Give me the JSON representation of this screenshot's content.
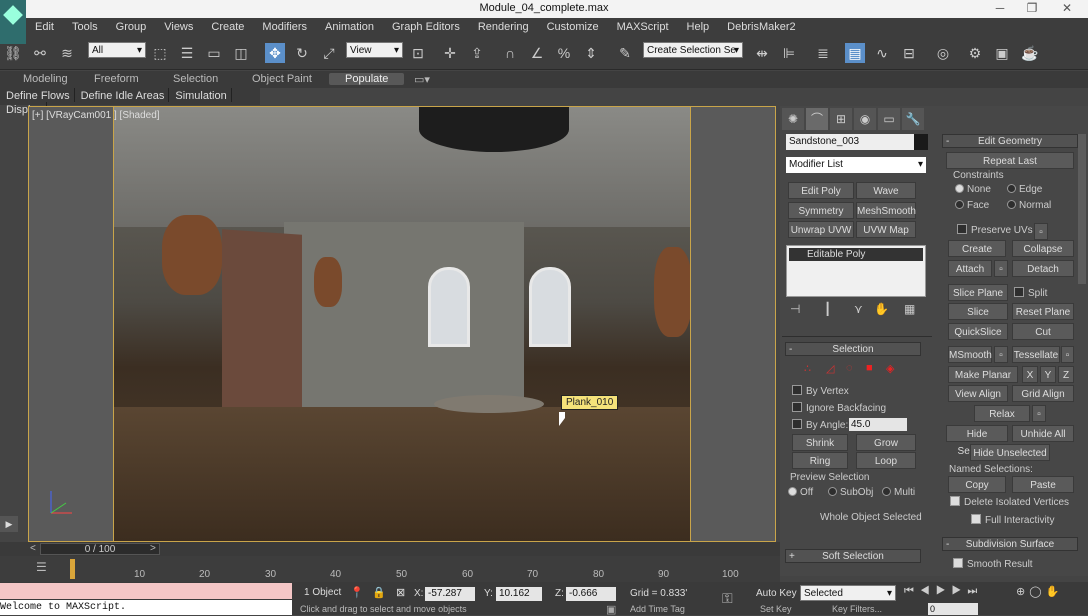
{
  "window": {
    "title": "Module_04_complete.max",
    "minimize": "─",
    "maximize": "❐",
    "close": "✕"
  },
  "menu": [
    "Edit",
    "Tools",
    "Group",
    "Views",
    "Create",
    "Modifiers",
    "Animation",
    "Graph Editors",
    "Rendering",
    "Customize",
    "MAXScript",
    "Help",
    "DebrisMaker2"
  ],
  "toolbar": {
    "filter": "All",
    "refcoord": "View",
    "selection_set_placeholder": "Create Selection Se"
  },
  "ribbon": {
    "tabs": [
      "Modeling",
      "Freeform",
      "Selection",
      "Object Paint",
      "Populate"
    ],
    "active": "Populate"
  },
  "subribbon": [
    "Define Flows",
    "Define Idle Areas",
    "Simulation",
    "Display"
  ],
  "viewport": {
    "label": "[+] [VRayCam001 ] [Shaded]",
    "tooltip": "Plank_010"
  },
  "command_panel": {
    "object_name": "Sandstone_003",
    "modifier_list": "Modifier List",
    "modifier_buttons": [
      "Edit Poly",
      "Wave",
      "Symmetry",
      "MeshSmooth",
      "Unwrap UVW",
      "UVW Map"
    ],
    "stack": [
      "Editable Poly"
    ],
    "selection": {
      "title": "Selection",
      "by_vertex": "By Vertex",
      "ignore_backfacing": "Ignore Backfacing",
      "by_angle": "By Angle:",
      "angle_value": "45.0",
      "shrink": "Shrink",
      "grow": "Grow",
      "ring": "Ring",
      "loop": "Loop",
      "preview_title": "Preview Selection",
      "preview_opts": [
        "Off",
        "SubObj",
        "Multi"
      ],
      "whole_object": "Whole Object Selected"
    },
    "soft_selection": "Soft Selection",
    "edit_geometry": {
      "title": "Edit Geometry",
      "repeat_last": "Repeat Last",
      "constraints": "Constraints",
      "constraint_opts": [
        "None",
        "Edge",
        "Face",
        "Normal"
      ],
      "preserve_uvs": "Preserve UVs",
      "create": "Create",
      "collapse": "Collapse",
      "attach": "Attach",
      "detach": "Detach",
      "slice_plane": "Slice Plane",
      "split": "Split",
      "slice": "Slice",
      "reset_plane": "Reset Plane",
      "quickslice": "QuickSlice",
      "cut": "Cut",
      "msmooth": "MSmooth",
      "tessellate": "Tessellate",
      "make_planar": "Make Planar",
      "x": "X",
      "y": "Y",
      "z": "Z",
      "view_align": "View Align",
      "grid_align": "Grid Align",
      "relax": "Relax",
      "hide_selected": "Hide Selected",
      "unhide_all": "Unhide All",
      "hide_unselected": "Hide Unselected",
      "named_selections": "Named Selections:",
      "copy": "Copy",
      "paste": "Paste",
      "delete_isolated": "Delete Isolated Vertices",
      "full_interactivity": "Full Interactivity"
    },
    "subdivision": {
      "title": "Subdivision Surface",
      "smooth_result": "Smooth Result"
    }
  },
  "timeline": {
    "frame": "0 / 100",
    "ticks": [
      "10",
      "20",
      "30",
      "40",
      "50",
      "60",
      "70",
      "80",
      "90",
      "100"
    ]
  },
  "status": {
    "objects": "1 Object",
    "x": "-57.287",
    "y": "10.162",
    "z": "-0.666",
    "grid": "Grid = 0.833'",
    "autokey": "Auto Key",
    "selected": "Selected",
    "setkey": "Set Key",
    "keyfilters": "Key Filters...",
    "prompt": "Click and drag to select and move objects",
    "add_time_tag": "Add Time Tag",
    "maxscript": "Welcome to MAXScript.",
    "frame_field": "0"
  }
}
